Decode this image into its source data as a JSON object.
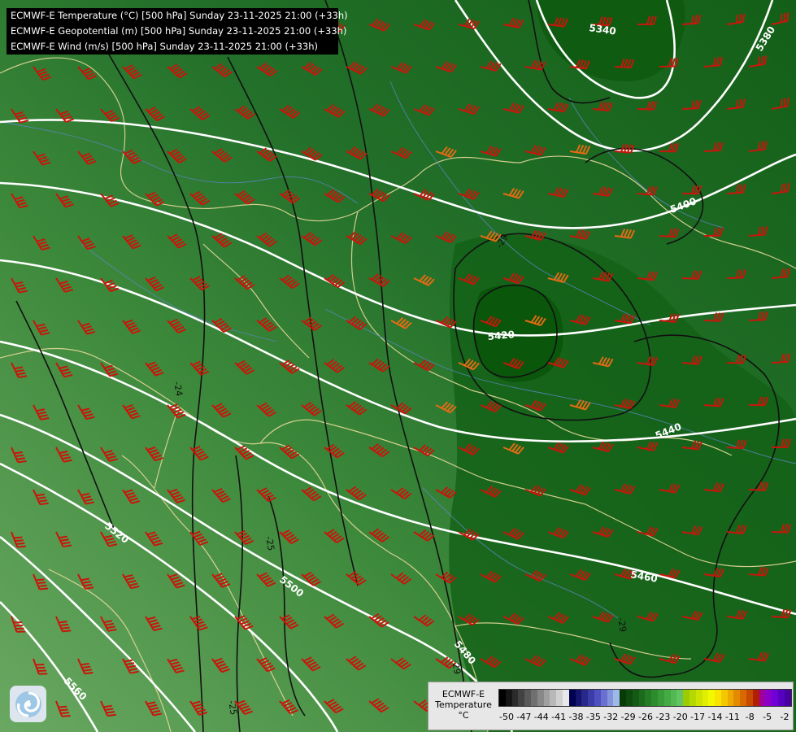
{
  "titles": [
    "ECMWF-E Temperature (°C) [500 hPa] Sunday 23-11-2025 21:00 (+33h)",
    "ECMWF-E Geopotential (m) [500 hPa] Sunday 23-11-2025 21:00 (+33h)",
    "ECMWF-E Wind (m/s) [500 hPa] Sunday 23-11-2025 21:00 (+33h)"
  ],
  "legend": {
    "title_lines": [
      "ECMWF-E",
      "Temperature",
      "°C"
    ],
    "ticks": [
      "-50",
      "-47",
      "-44",
      "-41",
      "-38",
      "-35",
      "-32",
      "-29",
      "-26",
      "-23",
      "-20",
      "-17",
      "-14",
      "-11",
      "-8",
      "-5",
      "-2"
    ],
    "colors": [
      "#000000",
      "#151515",
      "#2b2b2b",
      "#424242",
      "#595959",
      "#707070",
      "#888888",
      "#a0a0a0",
      "#b8b8b8",
      "#d0d0d0",
      "#e8e8e8",
      "#000050",
      "#14146e",
      "#28288a",
      "#3c3ca6",
      "#5050c0",
      "#6a70d0",
      "#8494dc",
      "#9eb8e8",
      "#063b06",
      "#0d4a0d",
      "#145a14",
      "#1c6b1c",
      "#247c24",
      "#2d8c2d",
      "#389c38",
      "#44ab44",
      "#52b852",
      "#62c462",
      "#9ccc00",
      "#b4d800",
      "#cce400",
      "#e0ef00",
      "#f2f800",
      "#f8e400",
      "#f4c800",
      "#eeaa00",
      "#e48a00",
      "#d86800",
      "#c84a00",
      "#b41e00",
      "#a000a0",
      "#8a00c8",
      "#7000d8",
      "#5800c0",
      "#4800a0"
    ]
  },
  "contour_labels": {
    "geopotential": [
      "5340",
      "5380",
      "5400",
      "5420",
      "5440",
      "5460",
      "5480",
      "5500",
      "5520",
      "5560"
    ],
    "temperature": [
      "-29",
      "-24",
      "-25",
      "-25",
      "-29",
      "-29"
    ]
  },
  "colors": {
    "background_light": "#5fa35a",
    "background_dark": "#0b5a0b",
    "wind_barbs": "#c8160c",
    "wind_barbs_strong": "#e36b14",
    "geopotential_contours": "#ffffff",
    "temperature_contours": "#000000",
    "borders": "#e6d89a",
    "rivers": "#5b86c0"
  },
  "logo": {
    "icon": "storm-swirl-icon"
  }
}
